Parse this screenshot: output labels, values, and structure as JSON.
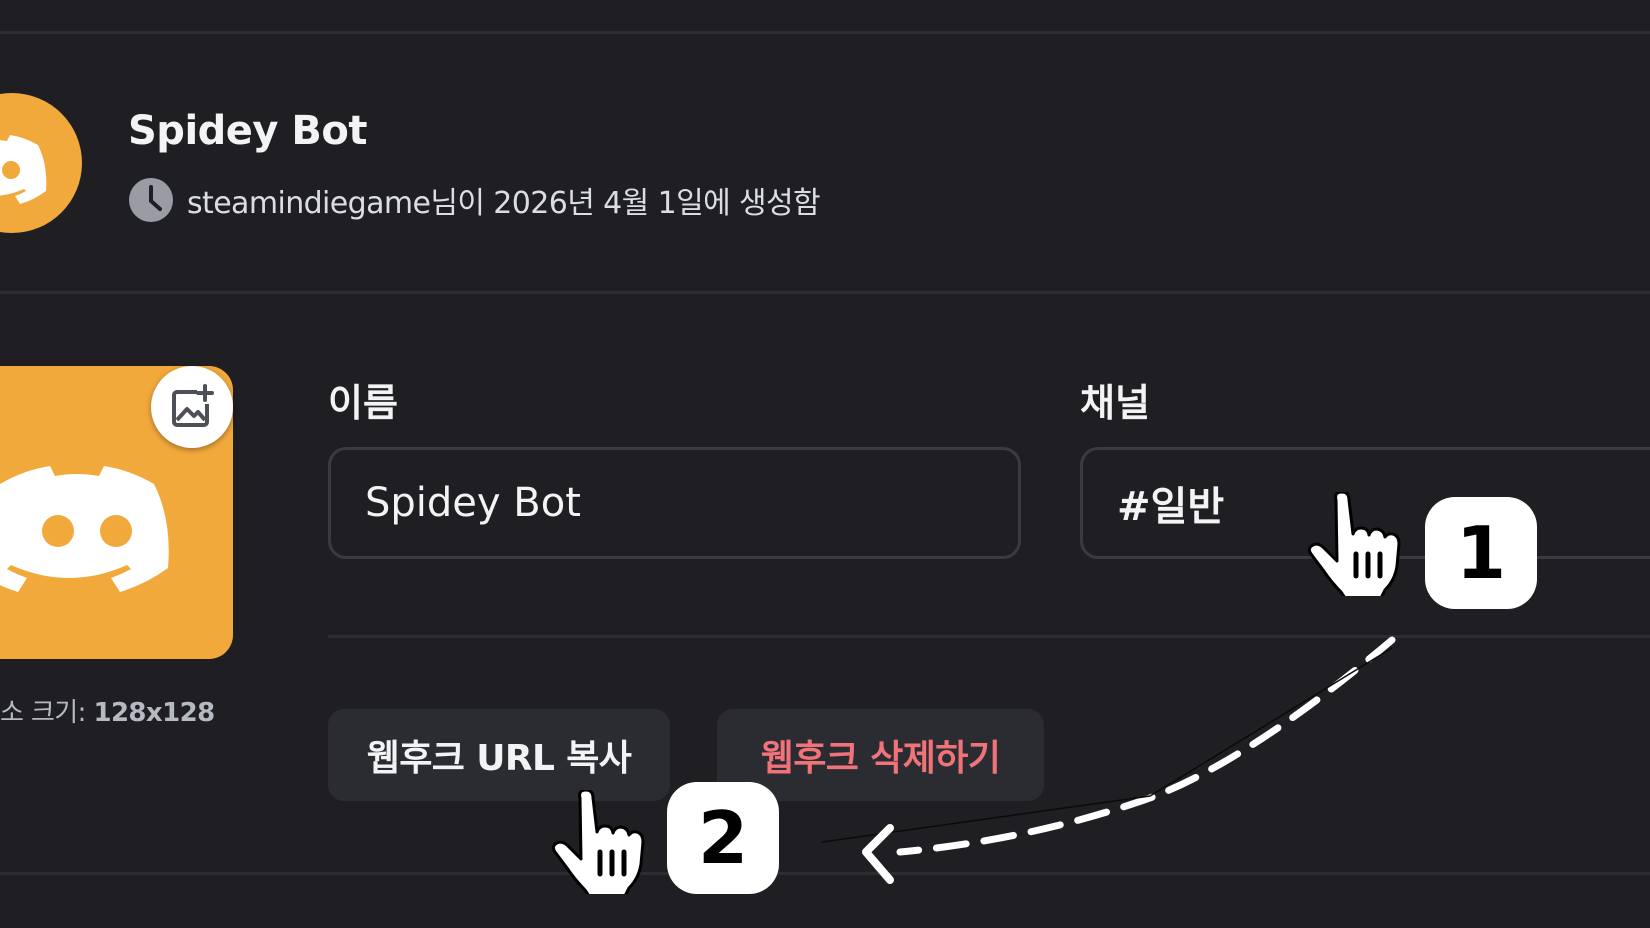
{
  "webhook": {
    "name": "Spidey Bot",
    "created_text": "steamindiegame님이 2026년 4월 1일에 생성함"
  },
  "avatar": {
    "size_label": "소 크기: ",
    "size_value": "128x128"
  },
  "form": {
    "name_label": "이름",
    "name_value": "Spidey Bot",
    "channel_label": "채널",
    "channel_value": "#일반"
  },
  "actions": {
    "copy_url_label": "웹후크 URL 복사",
    "delete_label": "웹후크 삭제하기"
  },
  "annotations": {
    "step1": "1",
    "step2": "2"
  },
  "colors": {
    "background": "#1f1f23",
    "brand_orange": "#f2a93b",
    "danger_text": "#f0737a",
    "button_bg": "#2b2c31"
  },
  "icons": [
    "discord-logo-icon",
    "clock-icon",
    "image-add-icon",
    "pointer-hand-icon",
    "dashed-arrow-icon"
  ]
}
